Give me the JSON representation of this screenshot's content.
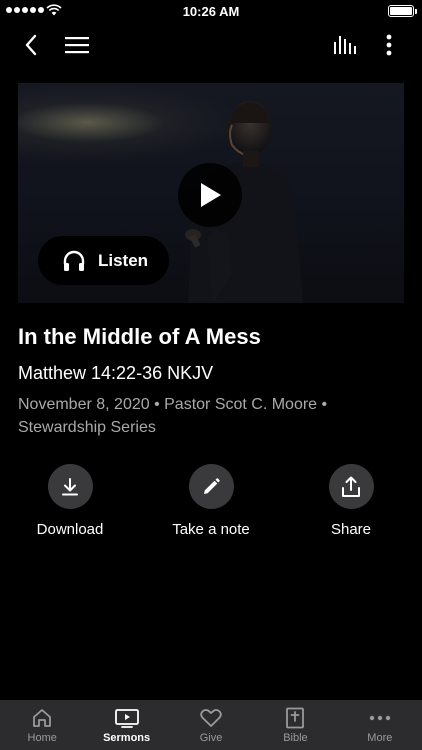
{
  "status_bar": {
    "time": "10:26 AM"
  },
  "top_nav": {
    "back_icon": "chevron-left-icon",
    "menu_icon": "hamburger-menu-icon",
    "audio_icon": "audio-bars-icon",
    "more_icon": "vertical-ellipsis-icon"
  },
  "hero": {
    "play_icon": "play-icon",
    "listen_label": "Listen",
    "listen_icon": "headphones-icon"
  },
  "sermon": {
    "title": "In the Middle of A Mess",
    "scripture": "Matthew 14:22-36 NKJV",
    "meta": "November 8, 2020 • Pastor Scot C. Moore • Stewardship Series"
  },
  "actions": [
    {
      "label": "Download",
      "icon": "download-icon"
    },
    {
      "label": "Take a note",
      "icon": "pencil-icon"
    },
    {
      "label": "Share",
      "icon": "share-icon"
    }
  ],
  "tabs": [
    {
      "label": "Home",
      "icon": "home-icon",
      "active": false
    },
    {
      "label": "Sermons",
      "icon": "video-play-icon",
      "active": true
    },
    {
      "label": "Give",
      "icon": "heart-icon",
      "active": false
    },
    {
      "label": "Bible",
      "icon": "bible-icon",
      "active": false
    },
    {
      "label": "More",
      "icon": "more-dots-icon",
      "active": false
    }
  ],
  "colors": {
    "background": "#000000",
    "tabbar": "#2c2c2e",
    "action_circle": "#3a3a3c",
    "meta_text": "#a9a9a9",
    "inactive_tab": "#9a9a9a"
  }
}
